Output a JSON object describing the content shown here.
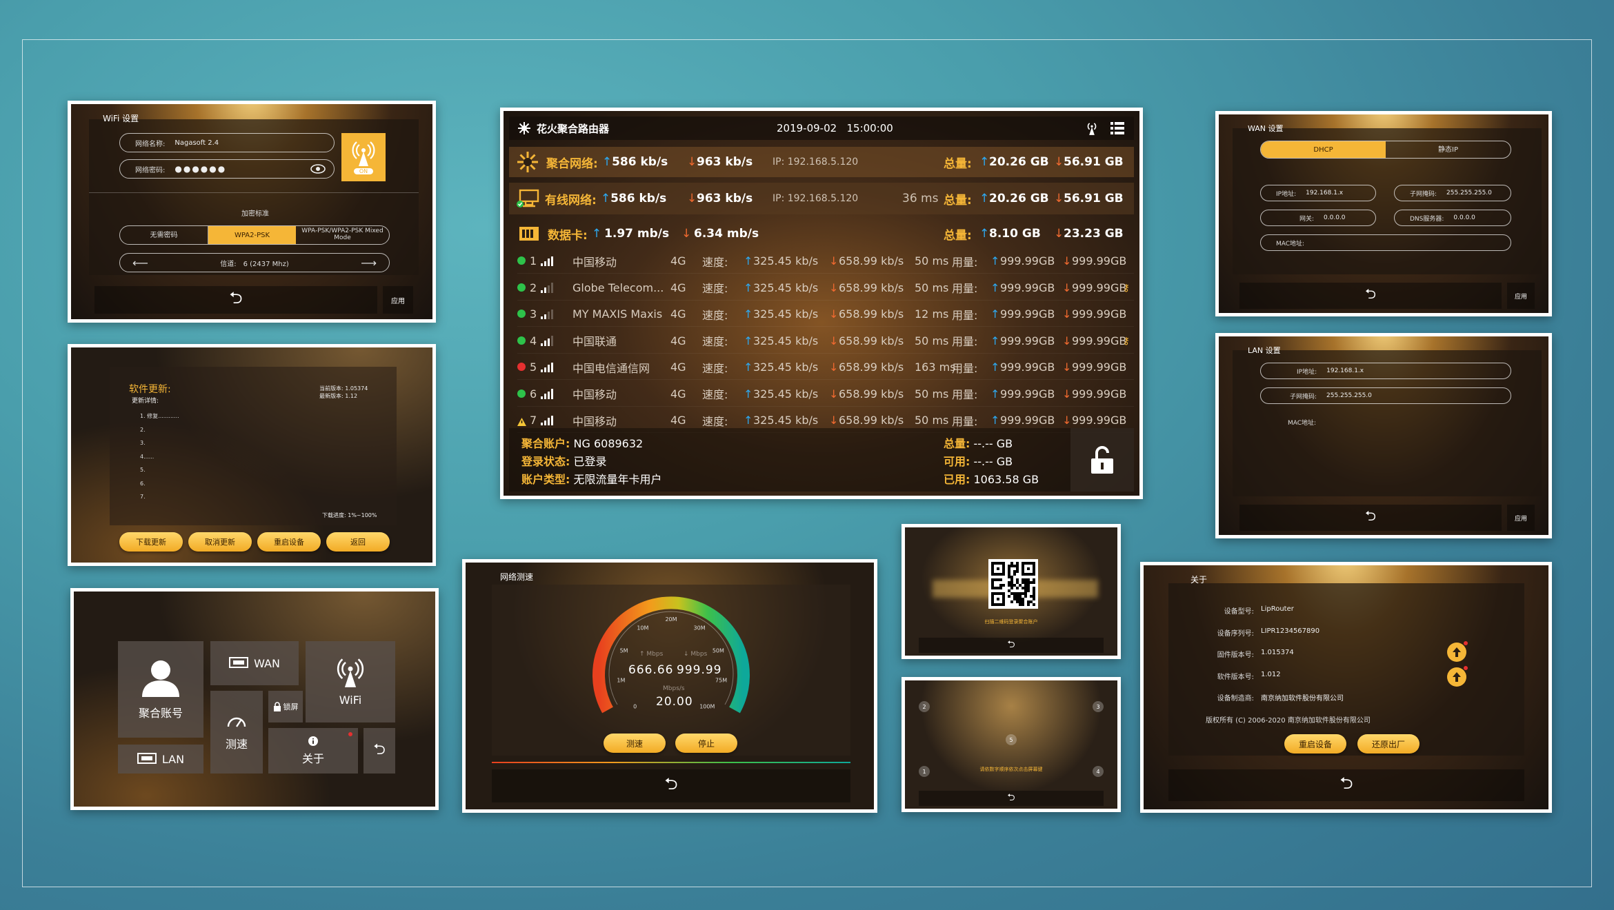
{
  "wifi": {
    "title": "WiFi 设置",
    "name_label": "网络名称:",
    "name_value": "Nagasoft 2.4",
    "pwd_label": "网络密码:",
    "pwd_value": "●●●●●●",
    "toggle": "ON",
    "enc_title": "加密标准",
    "enc_options": [
      "无需密码",
      "WPA2-PSK",
      "WPA-PSK/WPA2-PSK Mixed Mode"
    ],
    "channel_label": "信道:",
    "channel_value": "6 (2437 Mhz)",
    "apply": "应用"
  },
  "update": {
    "title": "软件更新:",
    "detail_label": "更新详情:",
    "current_version": "当前版本: 1.05374",
    "latest_version": "最新版本: 1.12",
    "items": [
      "1. 修复............",
      "2.",
      "3.",
      "4......",
      "5.",
      "6.",
      "7."
    ],
    "progress": "下载进度: 1%~100%",
    "buttons": [
      "下载更新",
      "取消更新",
      "重启设备",
      "返回"
    ]
  },
  "menu": {
    "account": "聚合账号",
    "wan": "WAN",
    "wifi": "WiFi",
    "lock": "锁屏",
    "speed": "测速",
    "lan": "LAN",
    "about": "关于"
  },
  "main": {
    "title": "花火聚合路由器",
    "datetime": "2019-09-02   15:00:00",
    "agg": {
      "label": "聚合网络:",
      "up": "586 kb/s",
      "down": "963 kb/s",
      "ip": "IP: 192.168.5.120",
      "total_label": "总量:",
      "total_up": "20.26 GB",
      "total_down": "56.91 GB"
    },
    "wired": {
      "label": "有线网络:",
      "up": "586 kb/s",
      "down": "963 kb/s",
      "ip": "IP: 192.168.5.120",
      "latency": "36 ms",
      "total_label": "总量:",
      "total_up": "20.26 GB",
      "total_down": "56.91 GB"
    },
    "data": {
      "label": "数据卡:",
      "up": "1.97 mb/s",
      "down": "6.34 mb/s",
      "total_label": "总量:",
      "total_up": "8.10 GB",
      "total_down": "23.23 GB"
    },
    "cards": [
      {
        "no": "1",
        "name": "中国移动",
        "net": "4G",
        "speed_label": "速度:",
        "up": "325.45 kb/s",
        "down": "658.99 kb/s",
        "latency": "50 ms",
        "usage_label": "用量:",
        "used_up": "999.99GB",
        "used_down": "999.99GB",
        "status": "ok",
        "bars": 4
      },
      {
        "no": "2",
        "name": "Globe Telecom...",
        "net": "4G",
        "speed_label": "速度:",
        "up": "325.45 kb/s",
        "down": "658.99 kb/s",
        "latency": "50 ms",
        "usage_label": "用量:",
        "used_up": "999.99GB",
        "used_down": "999.99GB",
        "status": "ok",
        "bars": 2
      },
      {
        "no": "3",
        "name": "MY MAXIS Maxis",
        "net": "4G",
        "speed_label": "速度:",
        "up": "325.45 kb/s",
        "down": "658.99 kb/s",
        "latency": "12 ms",
        "usage_label": "用量:",
        "used_up": "999.99GB",
        "used_down": "999.99GB",
        "status": "ok",
        "bars": 2
      },
      {
        "no": "4",
        "name": "中国联通",
        "net": "4G",
        "speed_label": "速度:",
        "up": "325.45 kb/s",
        "down": "658.99 kb/s",
        "latency": "50 ms",
        "usage_label": "用量:",
        "used_up": "999.99GB",
        "used_down": "999.99GB",
        "status": "ok",
        "bars": 3
      },
      {
        "no": "5",
        "name": "中国电信通信网",
        "net": "4G",
        "speed_label": "速度:",
        "up": "325.45 kb/s",
        "down": "658.99 kb/s",
        "latency": "163 ms",
        "usage_label": "用量:",
        "used_up": "999.99GB",
        "used_down": "999.99GB",
        "status": "error",
        "bars": 4
      },
      {
        "no": "6",
        "name": "中国移动",
        "net": "4G",
        "speed_label": "速度:",
        "up": "325.45 kb/s",
        "down": "658.99 kb/s",
        "latency": "50 ms",
        "usage_label": "用量:",
        "used_up": "999.99GB",
        "used_down": "999.99GB",
        "status": "ok",
        "bars": 4
      },
      {
        "no": "7",
        "name": "中国移动",
        "net": "4G",
        "speed_label": "速度:",
        "up": "325.45 kb/s",
        "down": "658.99 kb/s",
        "latency": "50 ms",
        "usage_label": "用量:",
        "used_up": "999.99GB",
        "used_down": "999.99GB",
        "status": "warn",
        "bars": 4
      }
    ],
    "account": {
      "label": "聚合账户:",
      "value": "NG 6089632"
    },
    "login": {
      "label": "登录状态:",
      "value": "已登录"
    },
    "type": {
      "label": "账户类型:",
      "value": "无限流量年卡用户"
    },
    "quota_total": {
      "label": "总量:",
      "value": "--.-- GB"
    },
    "quota_avail": {
      "label": "可用:",
      "value": "--.-- GB"
    },
    "quota_used": {
      "label": "已用:",
      "value": "1063.58 GB"
    }
  },
  "speedtest": {
    "title": "网络测速",
    "ticks": [
      "0",
      "1M",
      "5M",
      "10M",
      "20M",
      "30M",
      "50M",
      "75M",
      "100M"
    ],
    "up_label": "↑ Mbps",
    "down_label": "↓ Mbps",
    "up_value": "666.66",
    "down_value": "999.99",
    "unit": "Mbps/s",
    "value": "20.00",
    "buttons": [
      "测速",
      "停止"
    ]
  },
  "qr": {
    "caption": "扫描二维码登录聚合账户"
  },
  "pattern": {
    "caption": "请依数字顺序依次点击屏幕键",
    "numbers": [
      "1",
      "2",
      "3",
      "4",
      "5"
    ]
  },
  "wan": {
    "title": "WAN 设置",
    "modes": [
      "DHCP",
      "静态IP"
    ],
    "ip_label": "IP地址:",
    "ip_value": "192.168.1.x",
    "mask_label": "子网掩码:",
    "mask_value": "255.255.255.0",
    "gw_label": "网关:",
    "gw_value": "0.0.0.0",
    "dns_label": "DNS服务器:",
    "dns_value": "0.0.0.0",
    "mac_label": "MAC地址:",
    "apply": "应用"
  },
  "lan": {
    "title": "LAN 设置",
    "ip_label": "IP地址:",
    "ip_value": "192.168.1.x",
    "mask_label": "子网掩码:",
    "mask_value": "255.255.255.0",
    "mac_label": "MAC地址:",
    "apply": "应用"
  },
  "about": {
    "title": "关于",
    "rows": [
      {
        "label": "设备型号:",
        "value": "LipRouter"
      },
      {
        "label": "设备序列号:",
        "value": "LIPR1234567890"
      },
      {
        "label": "固件版本号:",
        "value": "1.015374"
      },
      {
        "label": "软件版本号:",
        "value": "1.012"
      },
      {
        "label": "设备制造商:",
        "value": "南京纳加软件股份有限公司"
      }
    ],
    "copyright": "版权所有 (C) 2006-2020 南京纳加软件股份有限公司",
    "buttons": [
      "重启设备",
      "还原出厂"
    ]
  },
  "colors": {
    "accent": "#f5b637",
    "up": "#2ea8ef",
    "down": "#f06a30",
    "ok": "#2ec24a",
    "error": "#e53030",
    "warn": "#f5c637"
  }
}
